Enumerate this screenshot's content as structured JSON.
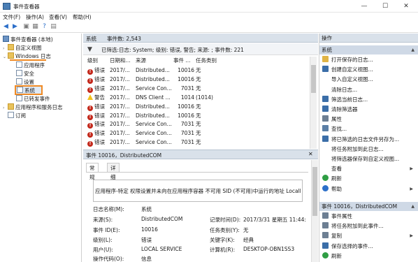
{
  "window": {
    "title": "事件查看器"
  },
  "menu": [
    "文件(F)",
    "操作(A)",
    "查看(V)",
    "帮助(H)"
  ],
  "tree": {
    "root": "事件查看器 (本地)",
    "items": [
      {
        "label": "自定义视图",
        "level": 1,
        "expander": "›"
      },
      {
        "label": "Windows 日志",
        "level": 1,
        "expander": "⌄"
      },
      {
        "label": "应用程序",
        "level": 2
      },
      {
        "label": "安全",
        "level": 2
      },
      {
        "label": "设置",
        "level": 2
      },
      {
        "label": "系统",
        "level": 2
      },
      {
        "label": "已转发事件",
        "level": 2
      },
      {
        "label": "应用程序和服务日志",
        "level": 1,
        "expander": "›"
      },
      {
        "label": "订阅",
        "level": 1
      }
    ]
  },
  "main": {
    "log_name": "系统",
    "event_count": "事件数: 2,543",
    "filter_text": "已筛选:日志: System; 级别: 错误, 警告; 来源: ; 事件数: 221",
    "columns": [
      "级别",
      "日期和...",
      "来源",
      "事件 ...",
      "任务类别"
    ],
    "rows": [
      {
        "level": "错误",
        "type": "error",
        "date": "2017/...",
        "source": "Distributed...",
        "id": "10016",
        "task": "无"
      },
      {
        "level": "错误",
        "type": "error",
        "date": "2017/...",
        "source": "Distributed...",
        "id": "10016",
        "task": "无"
      },
      {
        "level": "错误",
        "type": "error",
        "date": "2017/...",
        "source": "Service Con...",
        "id": "7031",
        "task": "无"
      },
      {
        "level": "警告",
        "type": "warn",
        "date": "2017/...",
        "source": "DNS Client ...",
        "id": "1014",
        "task": "(1014)"
      },
      {
        "level": "错误",
        "type": "error",
        "date": "2017/...",
        "source": "Distributed...",
        "id": "10016",
        "task": "无"
      },
      {
        "level": "错误",
        "type": "error",
        "date": "2017/...",
        "source": "Distributed...",
        "id": "10016",
        "task": "无"
      },
      {
        "level": "错误",
        "type": "error",
        "date": "2017/...",
        "source": "Service Con...",
        "id": "7031",
        "task": "无"
      },
      {
        "level": "错误",
        "type": "error",
        "date": "2017/...",
        "source": "Service Con...",
        "id": "7031",
        "task": "无"
      },
      {
        "level": "错误",
        "type": "error",
        "date": "2017/...",
        "source": "Service Con...",
        "id": "7031",
        "task": "无"
      }
    ]
  },
  "detail": {
    "header": "事件 10016，DistributedCOM",
    "tabs": [
      "常规",
      "详细信息"
    ],
    "description": "应用程序-特定 权限设置并未向在应用程序容器 不可用 SID (不可用)中运行的地址 LocalHo",
    "fields": {
      "log_name_label": "日志名称(M):",
      "log_name_value": "系统",
      "source_label": "来源(S):",
      "source_value": "DistributedCOM",
      "logged_label": "记录时间(D):",
      "logged_value": "2017/3/31 星期五 11:44:",
      "event_id_label": "事件 ID(E):",
      "event_id_value": "10016",
      "task_label": "任务类别(Y):",
      "task_value": "无",
      "level_label": "级别(L):",
      "level_value": "错误",
      "keywords_label": "关键字(K):",
      "keywords_value": "经典",
      "user_label": "用户(U):",
      "user_value": "LOCAL SERVICE",
      "computer_label": "计算机(R):",
      "computer_value": "DESKTOP-OBN1SS3",
      "opcode_label": "操作代码(O):",
      "opcode_value": "信息"
    }
  },
  "actions": {
    "header": "操作",
    "section1": "系统",
    "items1": [
      {
        "label": "打开保存的日志...",
        "icon": "open-log-icon"
      },
      {
        "label": "创建自定义视图...",
        "icon": "filter-create-icon"
      },
      {
        "label": "导入自定义视图...",
        "icon": ""
      },
      {
        "label": "清除日志...",
        "icon": ""
      },
      {
        "label": "筛选当前日志...",
        "icon": "filter-icon"
      },
      {
        "label": "清除筛选器",
        "icon": "clear-filter-icon"
      },
      {
        "label": "属性",
        "icon": "properties-icon"
      },
      {
        "label": "查找...",
        "icon": "find-icon"
      },
      {
        "label": "将已筛选的日志文件另存为...",
        "icon": "save-icon"
      },
      {
        "label": "将任务附加到此日志...",
        "icon": ""
      },
      {
        "label": "将筛选器保存到自定义视图...",
        "icon": ""
      },
      {
        "label": "查看",
        "icon": "",
        "submenu": true
      },
      {
        "label": "刷新",
        "icon": "refresh-icon"
      },
      {
        "label": "帮助",
        "icon": "help-icon",
        "submenu": true
      }
    ],
    "section2": "事件 10016，DistributedCOM",
    "items2": [
      {
        "label": "事件属性",
        "icon": "event-properties-icon"
      },
      {
        "label": "将任务附加到此事件...",
        "icon": "attach-task-icon"
      },
      {
        "label": "复制",
        "icon": "copy-icon",
        "submenu": true
      },
      {
        "label": "保存选择的事件...",
        "icon": "save-icon"
      },
      {
        "label": "刷新",
        "icon": "refresh-icon"
      }
    ]
  }
}
